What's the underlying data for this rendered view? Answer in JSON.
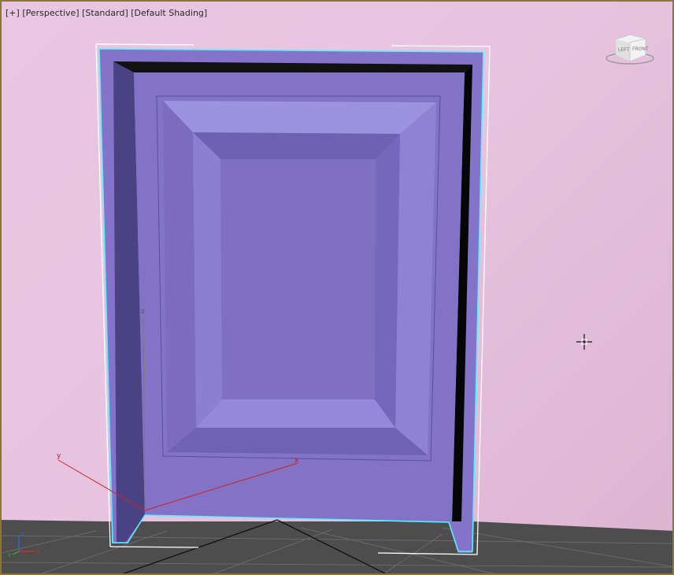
{
  "viewport": {
    "labels": [
      "[+]",
      "[Perspective]",
      "[Standard]",
      "[Default Shading]"
    ],
    "background": "#e8c5df",
    "border_color": "#8a7440"
  },
  "viewcube": {
    "left_face": "LEFT",
    "front_face": "FRONT"
  },
  "gizmo": {
    "x": "x",
    "y": "y",
    "z": "z"
  },
  "mini_axis": {
    "x": "x",
    "y": "y",
    "z": "z"
  },
  "colors": {
    "door": "#8676cc",
    "door_dark": "#4c4383",
    "frame_inner": "#050505",
    "floor": "#4d4d4d",
    "selection": "#58f0ff",
    "gizmo_x": "#d32020"
  },
  "icons": [
    "viewcube-icon",
    "move-crosshair-icon",
    "axis-tripod-icon"
  ]
}
